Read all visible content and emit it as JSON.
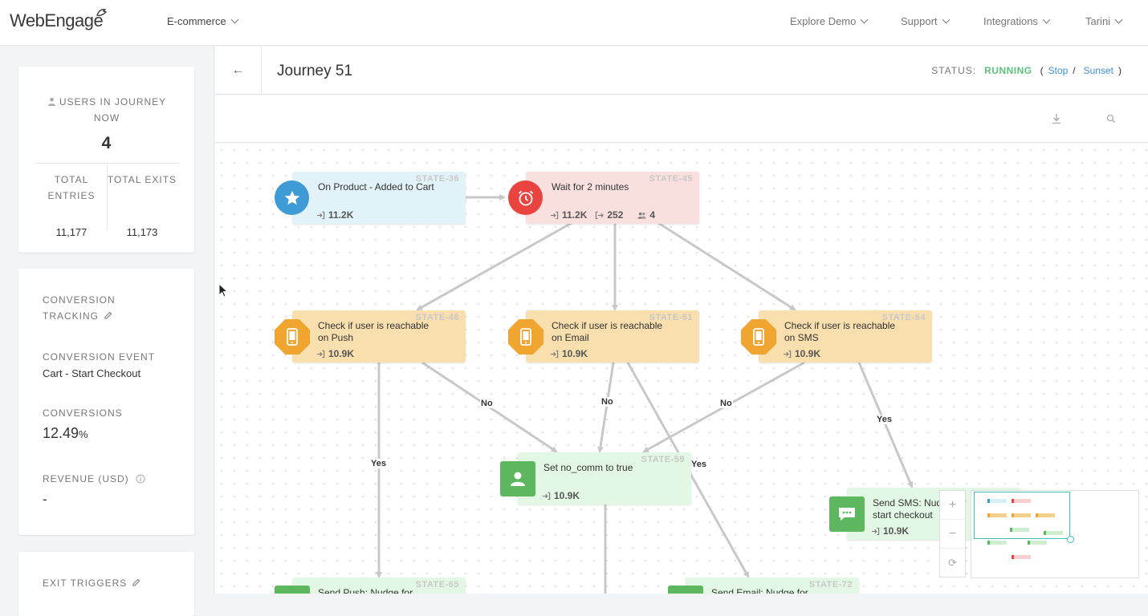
{
  "nav": {
    "logo": "WebEngage",
    "project": "E-commerce",
    "explore_demo": "Explore Demo",
    "support": "Support",
    "integrations": "Integrations",
    "user": "Tarini"
  },
  "sidebar": {
    "users_label": "USERS IN JOURNEY NOW",
    "users_value": "4",
    "entries_label": "TOTAL ENTRIES",
    "entries_value": "11,177",
    "exits_label": "TOTAL EXITS",
    "exits_value": "11,173",
    "conversion_tracking_label": "CONVERSION TRACKING",
    "conversion_event_label": "CONVERSION EVENT",
    "conversion_event_value": "Cart - Start Checkout",
    "conversions_label": "CONVERSIONS",
    "conversions_value": "12.49",
    "conversions_unit": "%",
    "revenue_label": "REVENUE (USD)",
    "revenue_value": "-",
    "exit_triggers_label": "EXIT TRIGGERS"
  },
  "header": {
    "back_glyph": "←",
    "title": "Journey 51",
    "status_label": "STATUS:",
    "status_value": "RUNNING",
    "open_paren": "(",
    "stop": "Stop",
    "slash": "/",
    "sunset": "Sunset",
    "close_paren": ")"
  },
  "colors": {
    "running": "#5cc27c",
    "link": "#3b8fd6",
    "trigger_blue": "#3f9bd6",
    "wait_red": "#e9443f",
    "check_orange": "#f0a530",
    "action_green": "#5cb75f"
  },
  "nodes": {
    "n36": {
      "state": "STATE-36",
      "title": "On Product - Added to Cart",
      "entries": "11.2K",
      "icon": "star-icon"
    },
    "n45": {
      "state": "STATE-45",
      "title": "Wait for 2 minutes",
      "entries": "11.2K",
      "exits": "252",
      "users": "4",
      "icon": "alarm-clock-icon"
    },
    "n48": {
      "state": "STATE-48",
      "title": "Check if user is  reachable on Push",
      "entries": "10.9K",
      "icon": "mobile-icon"
    },
    "n51": {
      "state": "STATE-51",
      "title": "Check if user is  reachable on Email",
      "entries": "10.9K",
      "icon": "mobile-icon"
    },
    "n54": {
      "state": "STATE-54",
      "title": "Check if user is  reachable on SMS",
      "entries": "10.9K",
      "icon": "mobile-icon"
    },
    "n59": {
      "state": "STATE-59",
      "title": "Set no_comm to true",
      "entries": "10.9K",
      "icon": "user-icon"
    },
    "n_sms": {
      "title": "Send SMS: Nudge for start checkout",
      "entries": "10.9K",
      "icon": "chat-icon"
    },
    "n65": {
      "state": "STATE-65",
      "title": "Send Push: Nudge for",
      "icon": "push-icon"
    },
    "n72": {
      "state": "STATE-72",
      "title": "Send Email: Nudge for",
      "icon": "email-icon"
    }
  },
  "edge_labels": {
    "push_yes": "Yes",
    "push_no": "No",
    "email_no": "No",
    "email_yes": "Yes",
    "sms_no": "No",
    "sms_yes": "Yes"
  },
  "zoom": {
    "in": "+",
    "out": "−",
    "reset": "⟳"
  }
}
